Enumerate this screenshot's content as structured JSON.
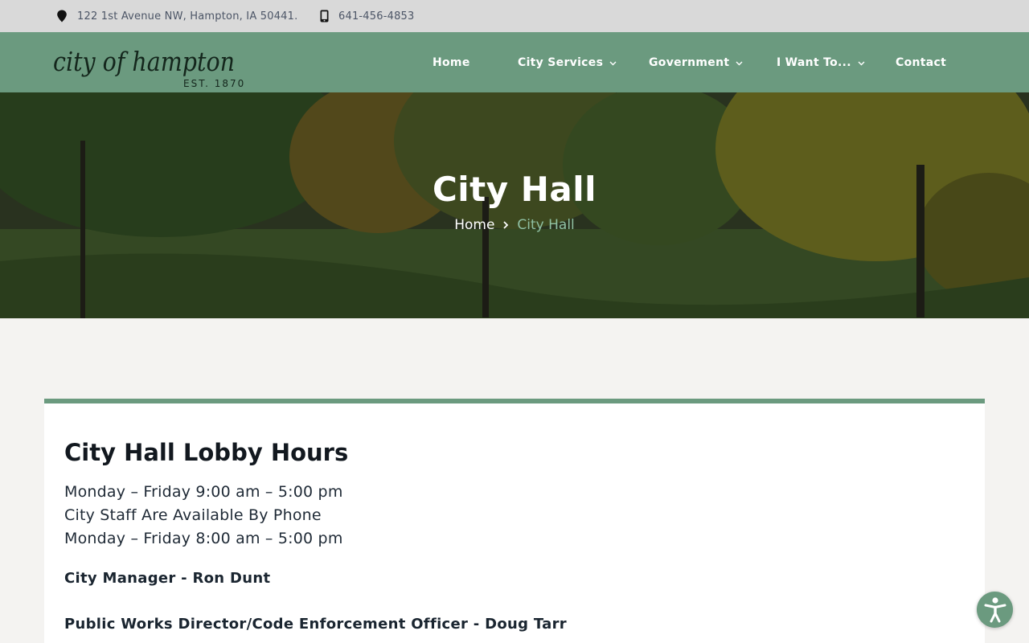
{
  "topbar": {
    "address": "122 1st Avenue NW, Hampton, IA 50441.",
    "address_icon": "map-pin-icon",
    "phone": "641-456-4853",
    "phone_icon": "mobile-phone-icon"
  },
  "brand": {
    "name": "city of hampton",
    "est": "EST. 1870"
  },
  "nav": {
    "home": "Home",
    "city_services": "City Services",
    "government": "Government",
    "i_want_to": "I Want To...",
    "contact": "Contact"
  },
  "hero": {
    "title": "City Hall",
    "breadcrumb": {
      "home": "Home",
      "current": "City Hall"
    }
  },
  "content": {
    "heading": "City Hall Lobby Hours",
    "lines": [
      "Monday – Friday 9:00 am – 5:00 pm",
      "City Staff Are Available By Phone",
      "Monday – Friday 8:00 am – 5:00 pm"
    ],
    "staff": [
      "City Manager - Ron Dunt",
      "Public Works Director/Code Enforcement Officer - Doug Tarr"
    ]
  },
  "colors": {
    "nav_green": "#6b9a7f",
    "topbar_gray": "#d9d9d9",
    "page_bg": "#f4f3f1",
    "breadcrumb_current": "#8fc0a3"
  },
  "accessibility": {
    "icon": "accessibility-icon"
  }
}
